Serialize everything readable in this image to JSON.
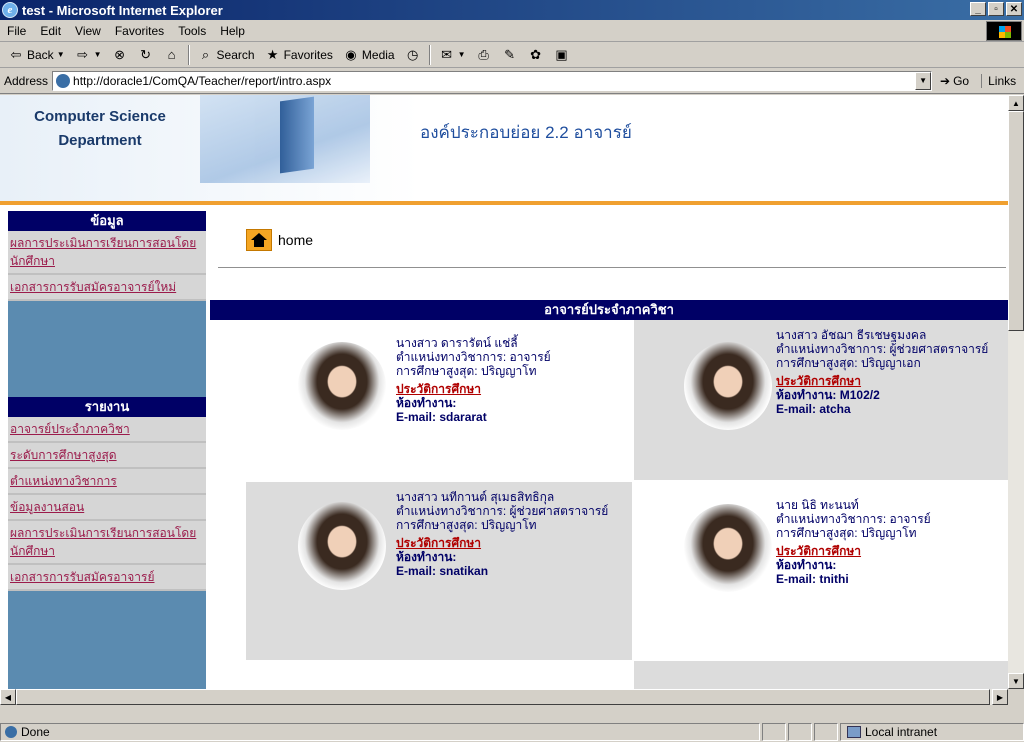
{
  "window": {
    "title": "test - Microsoft Internet Explorer"
  },
  "menu": [
    "File",
    "Edit",
    "View",
    "Favorites",
    "Tools",
    "Help"
  ],
  "toolbar": {
    "back": "Back",
    "search": "Search",
    "favorites": "Favorites",
    "media": "Media"
  },
  "address": {
    "label": "Address",
    "url": "http://doracle1/ComQA/Teacher/report/intro.aspx",
    "go": "Go",
    "links": "Links"
  },
  "header": {
    "dept": "Computer Science Department",
    "title": "องค์ประกอบย่อย 2.2 อาจารย์"
  },
  "sidebar": {
    "section1": "ข้อมูล",
    "items1": [
      "ผลการประเมินการเรียนการสอนโดยนักศึกษา",
      "เอกสารการรับสมัครอาจารย์ใหม่"
    ],
    "section2": "รายงาน",
    "items2": [
      "อาจารย์ประจำภาควิชา",
      "ระดับการศึกษาสูงสุด",
      "ตำแหน่งทางวิชาการ",
      "ข้อมูลงานสอน",
      "ผลการประเมินการเรียนการสอนโดยนักศึกษา",
      "เอกสารการรับสมัครอาจารย์"
    ]
  },
  "content": {
    "home": "home",
    "section_title": "อาจารย์ประจำภาควิชา",
    "history_label": "ประวัติการศึกษา",
    "teachers": [
      {
        "name": "นางสาว ดารารัตน์ แช่ลี้",
        "position": "ตำแหน่งทางวิชาการ: อาจารย์",
        "education": "การศึกษาสูงสุด: ปริญญาโท",
        "room": "ห้องทำงาน:",
        "email": "E-mail: sdararat"
      },
      {
        "name": "นางสาว อัชฌา ธีรเชษฐมงคล",
        "position": "ตำแหน่งทางวิชาการ: ผู้ช่วยศาสตราจารย์",
        "education": "การศึกษาสูงสุด: ปริญญาเอก",
        "room": "ห้องทำงาน: M102/2",
        "email": "E-mail: atcha"
      },
      {
        "name": "นางสาว นทีกานต์ สุเมธสิทธิกุล",
        "position": "ตำแหน่งทางวิชาการ: ผู้ช่วยศาสตราจารย์",
        "education": "การศึกษาสูงสุด: ปริญญาโท",
        "room": "ห้องทำงาน:",
        "email": "E-mail: snatikan"
      },
      {
        "name": "นาย นิธิ ทะนนท์",
        "position": "ตำแหน่งทางวิชาการ: อาจารย์",
        "education": "การศึกษาสูงสุด: ปริญญาโท",
        "room": "ห้องทำงาน:",
        "email": "E-mail: tnithi"
      }
    ]
  },
  "status": {
    "text": "Done",
    "zone": "Local intranet"
  }
}
